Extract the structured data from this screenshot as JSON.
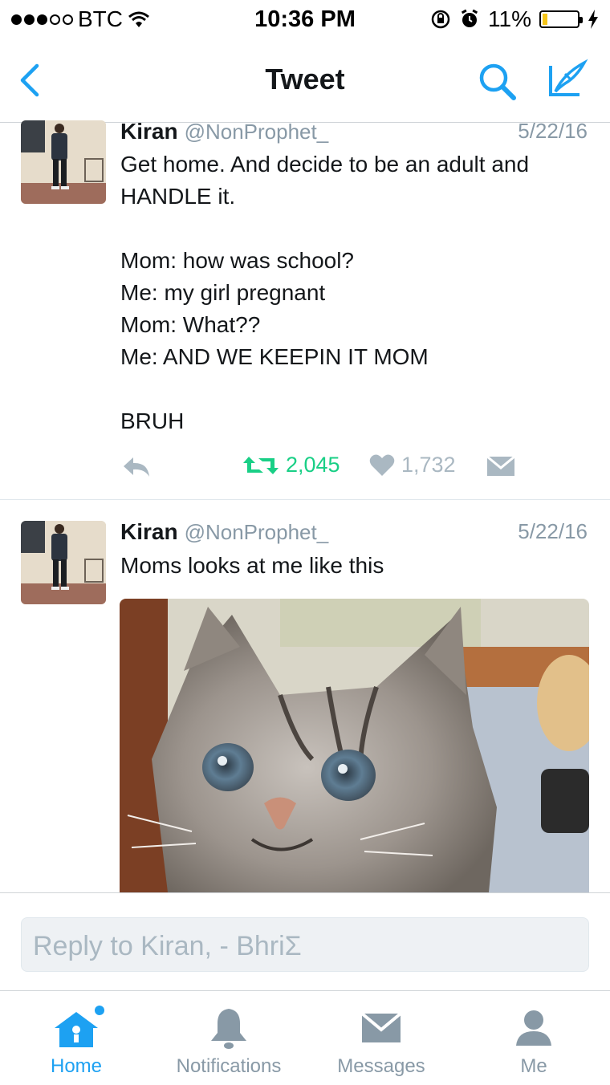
{
  "status_bar": {
    "carrier": "BTC",
    "time": "10:36 PM",
    "battery": "11%"
  },
  "nav": {
    "title": "Tweet"
  },
  "tweets": [
    {
      "name": "Kiran",
      "handle": "@NonProphet_",
      "date": "5/22/16",
      "text": "Get home. And decide to be an adult and HANDLE it.\n\nMom: how was school?\nMe: my girl pregnant\nMom: What??\nMe: AND WE KEEPIN IT MOM\n\nBRUH",
      "retweets": "2,045",
      "likes": "1,732"
    },
    {
      "name": "Kiran",
      "handle": "@NonProphet_",
      "date": "5/22/16",
      "text": "Moms looks at me like this"
    }
  ],
  "reply": {
    "placeholder": "Reply to Kiran, - BhriΣ"
  },
  "tabs": [
    {
      "label": "Home",
      "icon": "home-icon"
    },
    {
      "label": "Notifications",
      "icon": "bell-icon"
    },
    {
      "label": "Messages",
      "icon": "envelope-icon"
    },
    {
      "label": "Me",
      "icon": "person-icon"
    }
  ],
  "colors": {
    "accent": "#1da1f2",
    "retweet": "#19cf86",
    "muted": "#8899a6"
  }
}
